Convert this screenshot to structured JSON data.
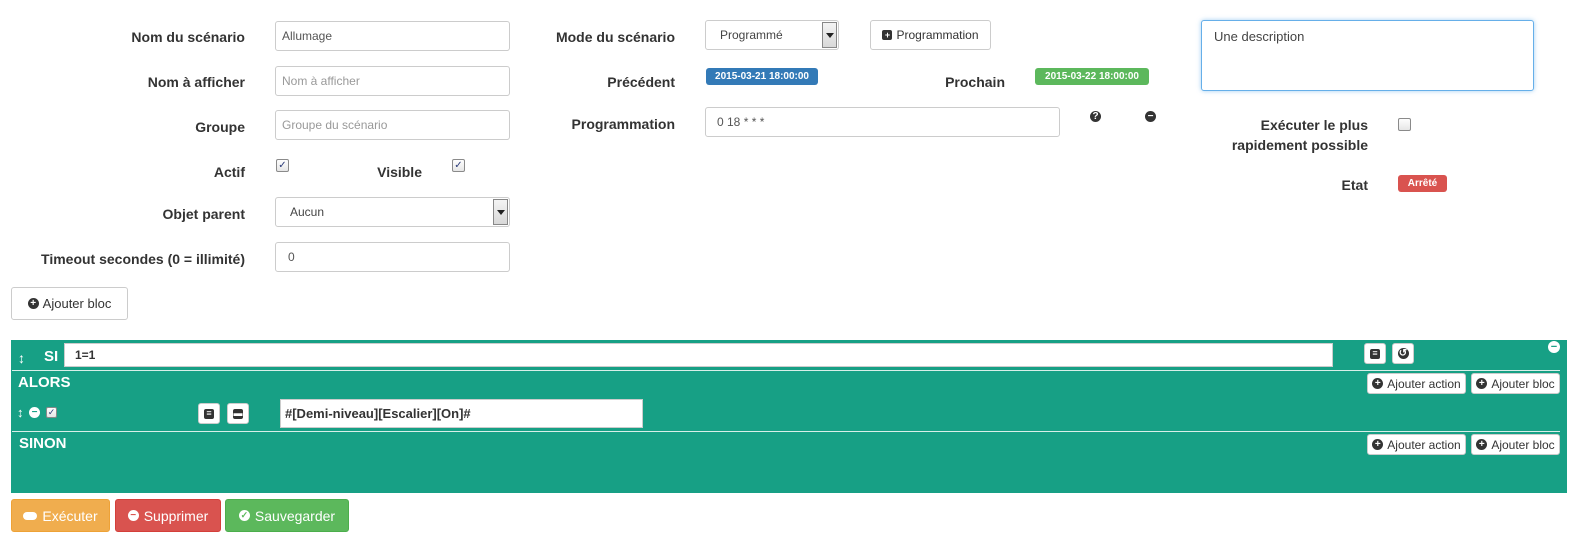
{
  "form": {
    "name_label": "Nom du scénario",
    "name_value": "Allumage",
    "display_label": "Nom à afficher",
    "display_placeholder": "Nom à afficher",
    "group_label": "Groupe",
    "group_placeholder": "Groupe du scénario",
    "active_label": "Actif",
    "active_checked": true,
    "visible_label": "Visible",
    "visible_checked": true,
    "parent_label": "Objet parent",
    "parent_value": "Aucun",
    "timeout_label": "Timeout secondes (0 = illimité)",
    "timeout_value": "0",
    "add_block_label": "Ajouter bloc"
  },
  "mode": {
    "mode_label": "Mode du scénario",
    "mode_value": "Programmé",
    "programmation_button": "Programmation",
    "previous_label": "Précédent",
    "previous_value": "2015-03-21 18:00:00",
    "next_label": "Prochain",
    "next_value": "2015-03-22 18:00:00",
    "schedule_label": "Programmation",
    "schedule_value": "0 18 * * *",
    "help_icon": "question-circle-icon",
    "remove_icon": "minus-circle-icon"
  },
  "right": {
    "description_value": "Une description",
    "run_fast_label_line1": "Exécuter le plus",
    "run_fast_label_line2": "rapidement possible",
    "run_fast_checked": false,
    "state_label": "Etat",
    "state_value": "Arrêté"
  },
  "block": {
    "si_label": "SI",
    "condition_value": "1=1",
    "alors_label": "ALORS",
    "sinon_label": "SINON",
    "add_action_label": "Ajouter action",
    "add_block_label": "Ajouter bloc",
    "action_value": "#[Demi-niveau][Escalier][On]#",
    "action_checked": true
  },
  "footer": {
    "execute_label": "Exécuter",
    "delete_label": "Supprimer",
    "save_label": "Sauvegarder"
  },
  "colors": {
    "block_green": "#17a085",
    "badge_blue": "#337ab7",
    "badge_green": "#5cb85c",
    "badge_red": "#d9534f",
    "btn_orange": "#f0ad4e",
    "btn_red": "#d9534f",
    "btn_green": "#5cb85c"
  }
}
